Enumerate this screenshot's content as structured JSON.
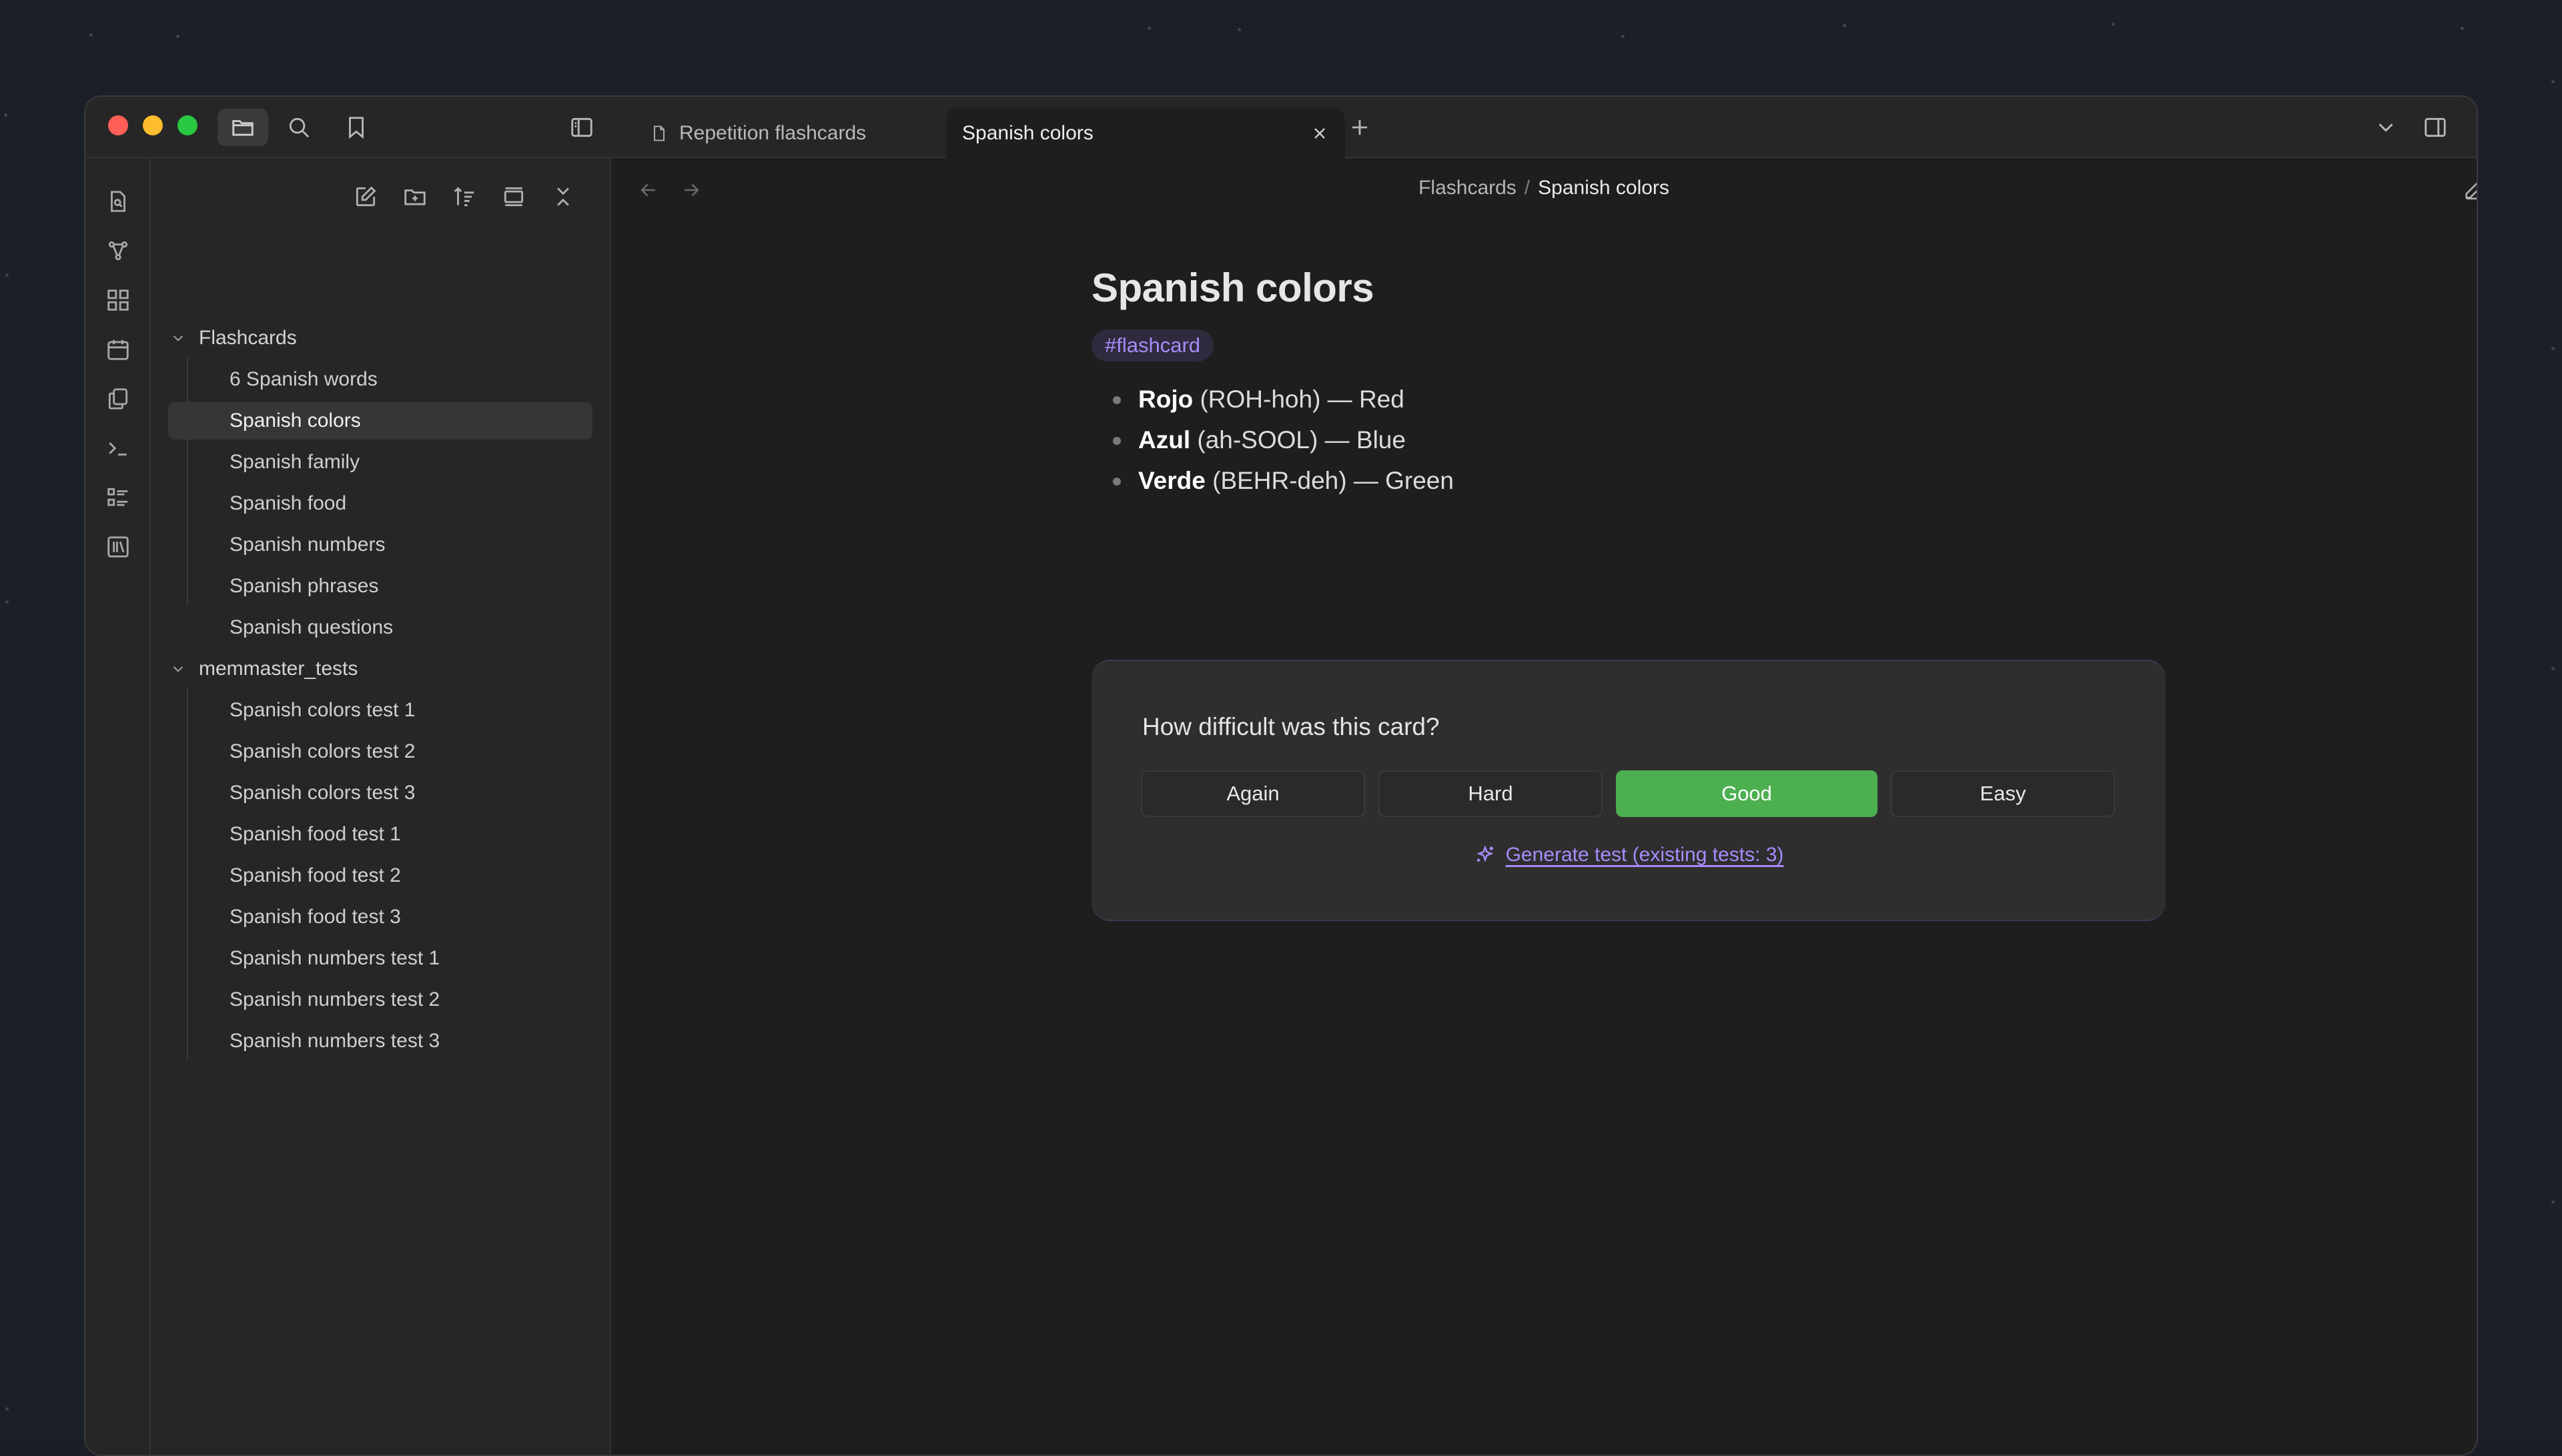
{
  "app": {
    "colors": {
      "accent": "#a78bfa",
      "good": "#4caf50",
      "traffic_close": "#ff5f57",
      "traffic_minimize": "#febc2e",
      "traffic_zoom": "#28c840"
    }
  },
  "titlebar": {
    "icons": [
      "folder-icon",
      "search-icon",
      "bookmark-icon",
      "sidebar-toggle-icon"
    ],
    "tabs": [
      {
        "label": "Repetition flashcards",
        "icon": "file-icon"
      },
      {
        "label": "Spanish colors",
        "close_icon": "close-icon"
      }
    ],
    "new_tab_icon": "plus-icon",
    "right_icons": [
      "chevron-down-icon",
      "right-sidebar-icon"
    ]
  },
  "ribbon": {
    "icons": [
      "quick-switcher-icon",
      "graph-icon",
      "canvas-icon",
      "calendar-icon",
      "templates-icon",
      "terminal-icon",
      "kanban-icon",
      "library-icon"
    ]
  },
  "sidebar": {
    "nav_icons": [
      "new-note-icon",
      "new-folder-icon",
      "sort-icon",
      "collapse-icon",
      "close-all-icon"
    ],
    "folders": [
      {
        "name": "Flashcards",
        "files": [
          "6 Spanish words",
          "Spanish colors",
          "Spanish family",
          "Spanish food",
          "Spanish numbers",
          "Spanish phrases",
          "Spanish questions"
        ]
      },
      {
        "name": "memmaster_tests",
        "files": [
          "Spanish colors test 1",
          "Spanish colors test 2",
          "Spanish colors test 3",
          "Spanish food test 1",
          "Spanish food test 2",
          "Spanish food test 3",
          "Spanish numbers test 1",
          "Spanish numbers test 2",
          "Spanish numbers test 3"
        ]
      }
    ],
    "active_file": "Spanish colors"
  },
  "main": {
    "breadcrumb": {
      "parent": "Flashcards",
      "sep": "/",
      "current": "Spanish colors"
    },
    "title": "Spanish colors",
    "tag": "#flashcard",
    "bullets": [
      {
        "word": "Rojo",
        "rest": " (ROH-hoh) — Red"
      },
      {
        "word": "Azul",
        "rest": " (ah-SOOL) — Blue"
      },
      {
        "word": "Verde",
        "rest": " (BEHR-deh) — Green"
      }
    ],
    "card": {
      "question": "How difficult was this card?",
      "buttons": [
        "Again",
        "Hard",
        "Good",
        "Easy"
      ],
      "generate_link": "Generate test (existing tests: 3)",
      "generate_icon": "sparkle-icon"
    }
  }
}
